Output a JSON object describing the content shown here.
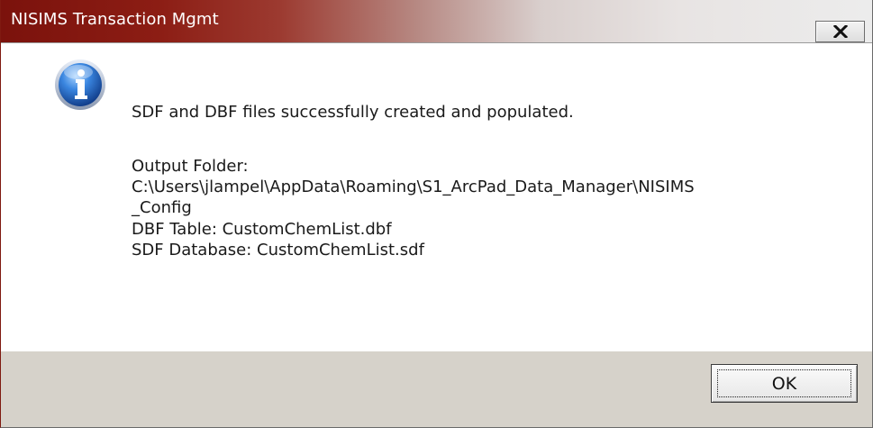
{
  "window": {
    "title": "NISIMS Transaction Mgmt",
    "close_icon": "close-icon"
  },
  "message": {
    "icon": "info-icon",
    "line1": "SDF  and DBF files successfully created and populated.",
    "line2": "Output Folder:",
    "line3": "C:\\Users\\jlampel\\AppData\\Roaming\\S1_ArcPad_Data_Manager\\NISIMS",
    "line4": "_Config",
    "line5": "DBF Table: CustomChemList.dbf",
    "line6": "SDF Database: CustomChemList.sdf"
  },
  "buttons": {
    "ok_label": "OK"
  },
  "colors": {
    "titlebar_accent": "#7b120c",
    "footer_bg": "#d6d2ca",
    "info_icon": "#2a6fc9"
  }
}
